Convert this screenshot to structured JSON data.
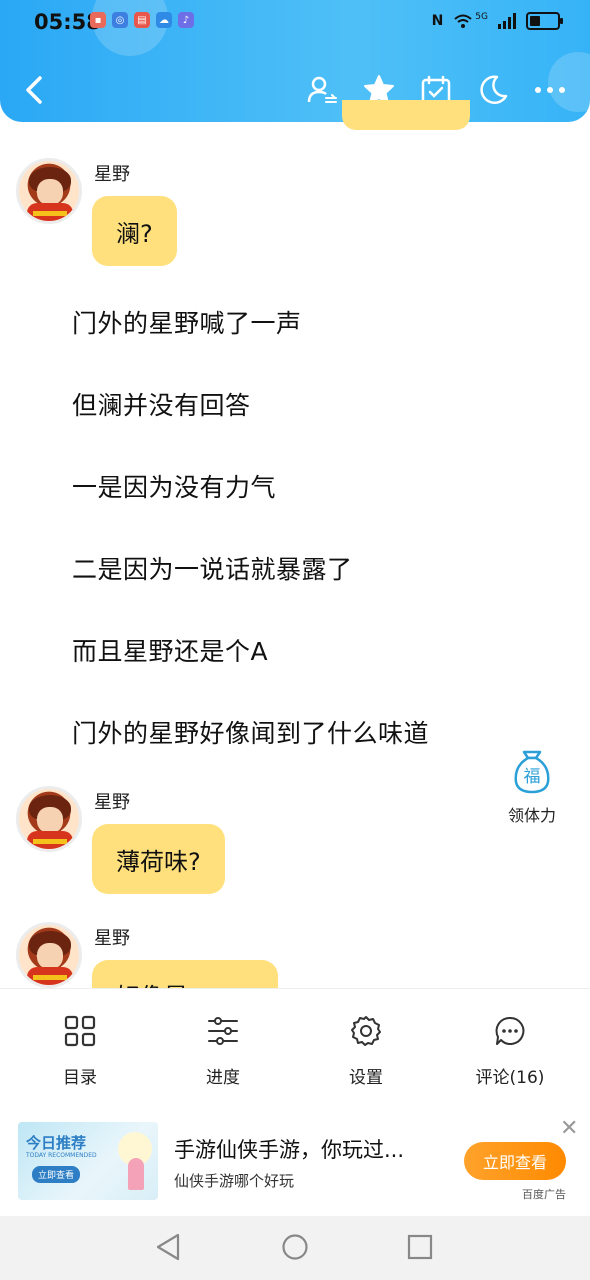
{
  "status_bar": {
    "time": "05:58",
    "network": "5G"
  },
  "header": {
    "back_icon": "chevron-left-icon",
    "actions": [
      "user-switch-icon",
      "star-icon",
      "calendar-check-icon",
      "moon-icon",
      "more-icon"
    ],
    "colors": {
      "gradient_start": "#2aa8f5",
      "gradient_end": "#36b3f7"
    }
  },
  "chat": {
    "messages": [
      {
        "sender": "星野",
        "text": "澜?"
      },
      {
        "sender": "星野",
        "text": "薄荷味?"
      },
      {
        "sender": "星野",
        "text": "好像是"
      }
    ],
    "narration": [
      "门外的星野喊了一声",
      "但澜并没有回答",
      "一是因为没有力气",
      "二是因为一说话就暴露了",
      "而且星野还是个A",
      "门外的星野好像闻到了什么味道"
    ],
    "bubble_color": "#ffe07d"
  },
  "floating": {
    "bag_char": "福",
    "label": "领体力"
  },
  "toolbar": {
    "items": [
      {
        "label": "目录",
        "icon": "grid-icon"
      },
      {
        "label": "进度",
        "icon": "sliders-icon"
      },
      {
        "label": "设置",
        "icon": "gear-icon"
      },
      {
        "label": "评论(16)",
        "icon": "comment-icon"
      }
    ]
  },
  "ad": {
    "image_title": "今日推荐",
    "image_subtitle": "TODAY RECOMMENDED",
    "image_button": "立即查看",
    "title": "手游仙侠手游，你玩过...",
    "subtitle": "仙侠手游哪个好玩",
    "button": "立即查看",
    "tag": "百度广告",
    "close": "✕"
  }
}
